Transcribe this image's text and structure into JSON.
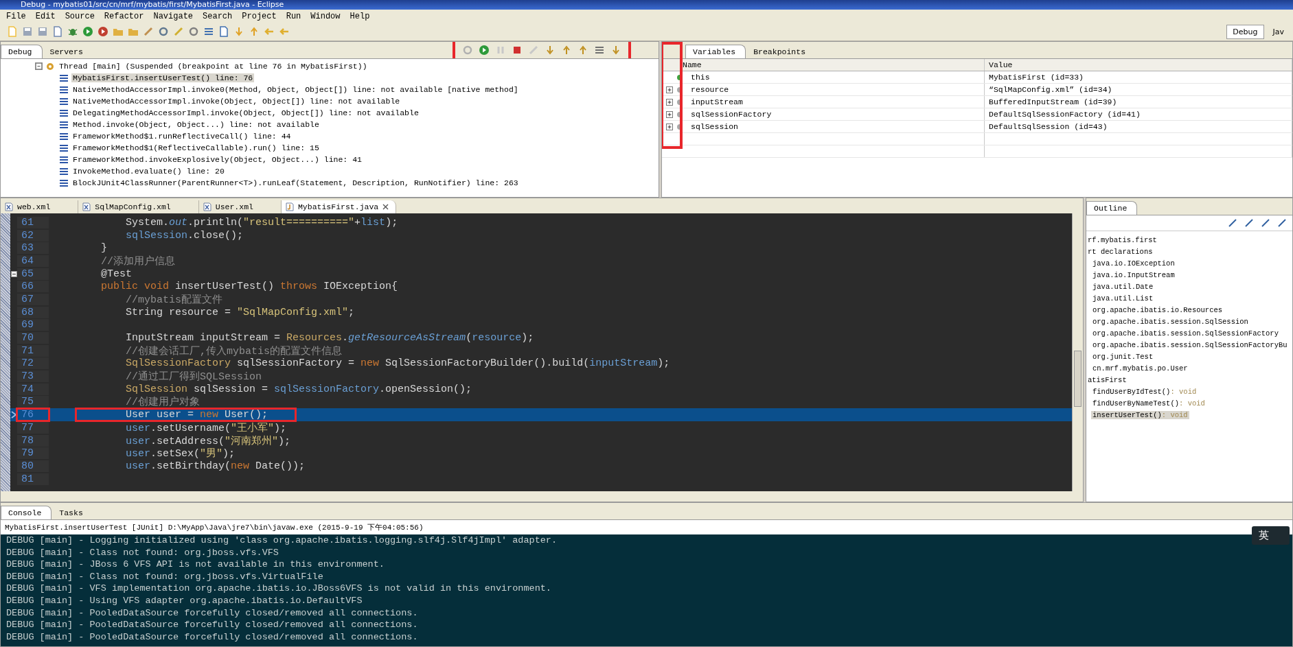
{
  "window": {
    "title": "Debug - mybatis01/src/cn/mrf/mybatis/first/MybatisFirst.java - Eclipse"
  },
  "menu": [
    "File",
    "Edit",
    "Source",
    "Refactor",
    "Navigate",
    "Search",
    "Project",
    "Run",
    "Window",
    "Help"
  ],
  "perspectives": [
    {
      "label": "Debug",
      "selected": true
    },
    {
      "label": "Jav",
      "selected": false
    }
  ],
  "debug_view": {
    "tabs": [
      {
        "label": "Debug",
        "selected": true
      },
      {
        "label": "Servers",
        "selected": false
      }
    ],
    "thread": {
      "label": "Thread [main] (Suspended (breakpoint at line 76 in MybatisFirst))",
      "expanded": true,
      "frames": [
        {
          "label": "MybatisFirst.insertUserTest() line: 76",
          "selected": true
        },
        {
          "label": "NativeMethodAccessorImpl.invoke0(Method, Object, Object[]) line: not available [native method]",
          "selected": false
        },
        {
          "label": "NativeMethodAccessorImpl.invoke(Object, Object[]) line: not available",
          "selected": false
        },
        {
          "label": "DelegatingMethodAccessorImpl.invoke(Object, Object[]) line: not available",
          "selected": false
        },
        {
          "label": "Method.invoke(Object, Object...) line: not available",
          "selected": false
        },
        {
          "label": "FrameworkMethod$1.runReflectiveCall() line: 44",
          "selected": false
        },
        {
          "label": "FrameworkMethod$1(ReflectiveCallable).run() line: 15",
          "selected": false
        },
        {
          "label": "FrameworkMethod.invokeExplosively(Object, Object...) line: 41",
          "selected": false
        },
        {
          "label": "InvokeMethod.evaluate() line: 20",
          "selected": false
        },
        {
          "label": "BlockJUnit4ClassRunner(ParentRunner<T>).runLeaf(Statement, Description, RunNotifier) line: 263",
          "selected": false
        }
      ]
    }
  },
  "variables_view": {
    "tabs": [
      {
        "label": "Variables",
        "selected": true
      },
      {
        "label": "Breakpoints",
        "selected": false
      }
    ],
    "columns": [
      "Name",
      "Value"
    ],
    "rows": [
      {
        "name": "this",
        "value": "MybatisFirst  (id=33)",
        "expandable": false,
        "color": "#3fa33f"
      },
      {
        "name": "resource",
        "value": "“SqlMapConfig.xml” (id=34)",
        "expandable": true,
        "color": "#a8a8a8"
      },
      {
        "name": "inputStream",
        "value": "BufferedInputStream  (id=39)",
        "expandable": true,
        "color": "#a8a8a8"
      },
      {
        "name": "sqlSessionFactory",
        "value": "DefaultSqlSessionFactory  (id=41)",
        "expandable": true,
        "color": "#a8a8a8"
      },
      {
        "name": "sqlSession",
        "value": "DefaultSqlSession  (id=43)",
        "expandable": true,
        "color": "#a8a8a8"
      }
    ]
  },
  "editor": {
    "tabs": [
      {
        "label": "web.xml",
        "kind": "xml",
        "selected": false
      },
      {
        "label": "SqlMapConfig.xml",
        "kind": "xml",
        "selected": false
      },
      {
        "label": "User.xml",
        "kind": "xml",
        "selected": false
      },
      {
        "label": "MybatisFirst.java",
        "kind": "java",
        "selected": true
      }
    ],
    "lines": [
      {
        "number": "61",
        "current": false,
        "segments": [
          {
            "kind": "plain",
            "text": "        System."
          },
          {
            "kind": "static",
            "text": "out"
          },
          {
            "kind": "plain",
            "text": ".println("
          },
          {
            "kind": "string",
            "text": "\"result==========\""
          },
          {
            "kind": "plain",
            "text": "+"
          },
          {
            "kind": "field",
            "text": "list"
          },
          {
            "kind": "plain",
            "text": ");"
          }
        ]
      },
      {
        "number": "62",
        "current": false,
        "segments": [
          {
            "kind": "field",
            "text": "        sqlSession"
          },
          {
            "kind": "plain",
            "text": ".close();"
          }
        ]
      },
      {
        "number": "63",
        "current": false,
        "segments": [
          {
            "kind": "plain",
            "text": "    }"
          }
        ]
      },
      {
        "number": "64",
        "current": false,
        "segments": [
          {
            "kind": "comment",
            "text": "    //添加用户信息"
          }
        ]
      },
      {
        "number": "65",
        "current": false,
        "kind": "fold",
        "segments": [
          {
            "kind": "plain",
            "text": "    @Test"
          }
        ]
      },
      {
        "number": "66",
        "current": false,
        "segments": [
          {
            "kind": "keyword",
            "text": "    public void"
          },
          {
            "kind": "plain",
            "text": " insertUserTest() "
          },
          {
            "kind": "keyword",
            "text": "throws"
          },
          {
            "kind": "plain",
            "text": " IOException{"
          }
        ]
      },
      {
        "number": "67",
        "current": false,
        "segments": [
          {
            "kind": "comment",
            "text": "        //mybatis配置文件"
          }
        ]
      },
      {
        "number": "68",
        "current": false,
        "segments": [
          {
            "kind": "plain",
            "text": "        String resource = "
          },
          {
            "kind": "string",
            "text": "\"SqlMapConfig.xml\""
          },
          {
            "kind": "plain",
            "text": ";"
          }
        ]
      },
      {
        "number": "69",
        "current": false
      },
      {
        "number": "70",
        "current": false,
        "segments": [
          {
            "kind": "plain",
            "text": "        InputStream inputStream = "
          },
          {
            "kind": "type",
            "text": "Resources"
          },
          {
            "kind": "plain",
            "text": "."
          },
          {
            "kind": "static",
            "text": "getResourceAsStream"
          },
          {
            "kind": "plain",
            "text": "("
          },
          {
            "kind": "field",
            "text": "resource"
          },
          {
            "kind": "plain",
            "text": ");"
          }
        ]
      },
      {
        "number": "71",
        "current": false,
        "segments": [
          {
            "kind": "comment",
            "text": "        //创建会话工厂,传入mybatis的配置文件信息"
          }
        ]
      },
      {
        "number": "72",
        "current": false,
        "segments": [
          {
            "kind": "type",
            "text": "        SqlSessionFactory"
          },
          {
            "kind": "plain",
            "text": " sqlSessionFactory = "
          },
          {
            "kind": "keyword",
            "text": "new"
          },
          {
            "kind": "plain",
            "text": " SqlSessionFactoryBuilder().build("
          },
          {
            "kind": "field",
            "text": "inputStream"
          },
          {
            "kind": "plain",
            "text": ");"
          }
        ]
      },
      {
        "number": "73",
        "current": false,
        "segments": [
          {
            "kind": "comment",
            "text": "        //通过工厂得到SQLSession"
          }
        ]
      },
      {
        "number": "74",
        "current": false,
        "segments": [
          {
            "kind": "type",
            "text": "        SqlSession"
          },
          {
            "kind": "plain",
            "text": " sqlSession = "
          },
          {
            "kind": "field",
            "text": "sqlSessionFactory"
          },
          {
            "kind": "plain",
            "text": ".openSession();"
          }
        ]
      },
      {
        "number": "75",
        "current": false,
        "segments": [
          {
            "kind": "comment",
            "text": "        //创建用户对象"
          }
        ]
      },
      {
        "number": "76",
        "current": true,
        "kind": "instruction-pointer",
        "segments": [
          {
            "kind": "plain",
            "text": "        User user = "
          },
          {
            "kind": "keyword",
            "text": "new"
          },
          {
            "kind": "plain",
            "text": " User();"
          }
        ]
      },
      {
        "number": "77",
        "current": false,
        "segments": [
          {
            "kind": "field",
            "text": "        user"
          },
          {
            "kind": "plain",
            "text": ".setUsername("
          },
          {
            "kind": "string",
            "text": "\"王小军\""
          },
          {
            "kind": "plain",
            "text": ");"
          }
        ]
      },
      {
        "number": "78",
        "current": false,
        "segments": [
          {
            "kind": "field",
            "text": "        user"
          },
          {
            "kind": "plain",
            "text": ".setAddress("
          },
          {
            "kind": "string",
            "text": "\"河南郑州\""
          },
          {
            "kind": "plain",
            "text": ");"
          }
        ]
      },
      {
        "number": "79",
        "current": false,
        "segments": [
          {
            "kind": "field",
            "text": "        user"
          },
          {
            "kind": "plain",
            "text": ".setSex("
          },
          {
            "kind": "string",
            "text": "\"男\""
          },
          {
            "kind": "plain",
            "text": ");"
          }
        ]
      },
      {
        "number": "80",
        "current": false,
        "segments": [
          {
            "kind": "field",
            "text": "        user"
          },
          {
            "kind": "plain",
            "text": ".setBirthday("
          },
          {
            "kind": "keyword",
            "text": "new"
          },
          {
            "kind": "plain",
            "text": " Date());"
          }
        ]
      },
      {
        "number": "81",
        "current": false
      }
    ]
  },
  "outline": {
    "tab": {
      "label": "Outline",
      "selected": true
    },
    "items": [
      {
        "label": "rf.mybatis.first",
        "selected": false
      },
      {
        "label": "rt declarations",
        "selected": false,
        "children": [
          {
            "label": "java.io.IOException",
            "selected": false
          },
          {
            "label": "java.io.InputStream",
            "selected": false
          },
          {
            "label": "java.util.Date",
            "selected": false
          },
          {
            "label": "java.util.List",
            "selected": false
          },
          {
            "label": "org.apache.ibatis.io.Resources",
            "selected": false
          },
          {
            "label": "org.apache.ibatis.session.SqlSession",
            "selected": false
          },
          {
            "label": "org.apache.ibatis.session.SqlSessionFactory",
            "selected": false
          },
          {
            "label": "org.apache.ibatis.session.SqlSessionFactoryBu",
            "selected": false
          },
          {
            "label": "org.junit.Test",
            "selected": false
          },
          {
            "label": "cn.mrf.mybatis.po.User",
            "selected": false
          }
        ]
      },
      {
        "label": "atisFirst",
        "selected": false,
        "children": [
          {
            "label": "findUserByIdTest()",
            "type": ": void",
            "selected": false
          },
          {
            "label": "findUserByNameTest()",
            "type": ": void",
            "selected": false
          },
          {
            "label": "insertUserTest()",
            "type": ": void",
            "selected": true
          }
        ]
      }
    ]
  },
  "console": {
    "tabs": [
      {
        "label": "Console",
        "selected": true
      },
      {
        "label": "Tasks",
        "selected": false
      }
    ],
    "header": "MybatisFirst.insertUserTest [JUnit] D:\\MyApp\\Java\\jre7\\bin\\javaw.exe (2015-9-19 下午04:05:56)",
    "lines": [
      "DEBUG [main] - Logging initialized using 'class org.apache.ibatis.logging.slf4j.Slf4jImpl' adapter.",
      "DEBUG [main] - Class not found: org.jboss.vfs.VFS",
      "DEBUG [main] - JBoss 6 VFS API is not available in this environment.",
      "DEBUG [main] - Class not found: org.jboss.vfs.VirtualFile",
      "DEBUG [main] - VFS implementation org.apache.ibatis.io.JBoss6VFS is not valid in this environment.",
      "DEBUG [main] - Using VFS adapter org.apache.ibatis.io.DefaultVFS",
      "DEBUG [main] - PooledDataSource forcefully closed/removed all connections.",
      "DEBUG [main] - PooledDataSource forcefully closed/removed all connections.",
      "DEBUG [main] - PooledDataSource forcefully closed/removed all connections."
    ]
  },
  "ime": {
    "label": "英"
  }
}
